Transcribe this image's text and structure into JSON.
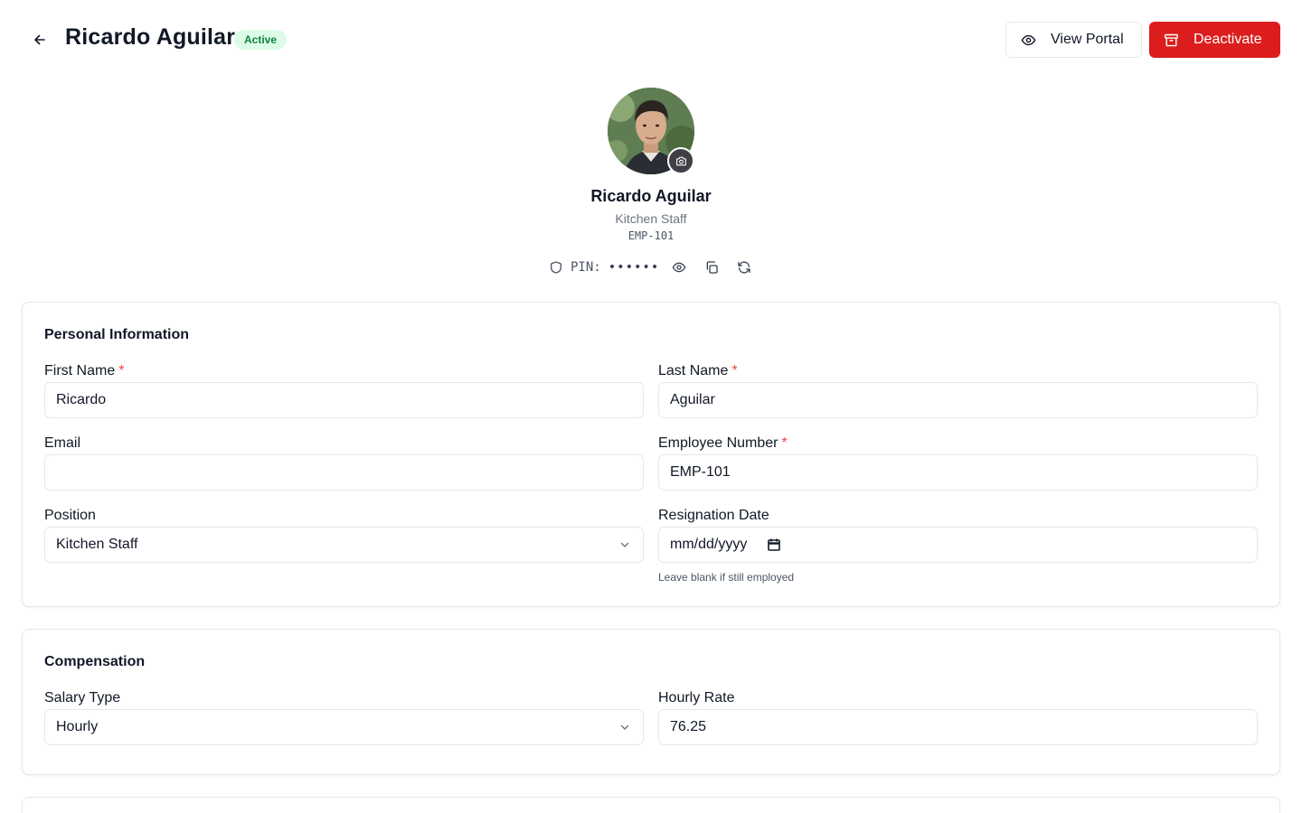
{
  "header": {
    "title": "Ricardo Aguilar",
    "status_badge": "Active",
    "view_portal_label": "View Portal",
    "deactivate_label": "Deactivate"
  },
  "profile": {
    "name": "Ricardo Aguilar",
    "position": "Kitchen Staff",
    "employee_number": "EMP-101",
    "pin_label": "PIN:",
    "pin_value": "••••••"
  },
  "personal": {
    "section_title": "Personal Information",
    "first_name_label": "First Name",
    "first_name_value": "Ricardo",
    "last_name_label": "Last Name",
    "last_name_value": "Aguilar",
    "email_label": "Email",
    "email_value": "",
    "employee_number_label": "Employee Number",
    "employee_number_value": "EMP-101",
    "position_label": "Position",
    "position_value": "Kitchen Staff",
    "resignation_label": "Resignation Date",
    "resignation_placeholder": "mm/dd/yyyy",
    "resignation_hint": "Leave blank if still employed",
    "required_marker": "*"
  },
  "compensation": {
    "section_title": "Compensation",
    "salary_type_label": "Salary Type",
    "salary_type_value": "Hourly",
    "hourly_rate_label": "Hourly Rate",
    "hourly_rate_value": "76.25"
  },
  "colors": {
    "accent_red": "#dc1d1d",
    "badge_bg": "#dcfce7",
    "badge_text": "#15803d",
    "border": "#e5e7eb"
  },
  "icons": {
    "back": "arrow-left-icon",
    "portal": "eye-icon",
    "deactivate": "archive-icon",
    "camera": "camera-icon",
    "pin_shield": "shield-icon",
    "pin_reveal": "eye-icon",
    "pin_copy": "copy-icon",
    "pin_regenerate": "refresh-icon",
    "select": "chevron-down-icon",
    "date": "calendar-icon"
  }
}
